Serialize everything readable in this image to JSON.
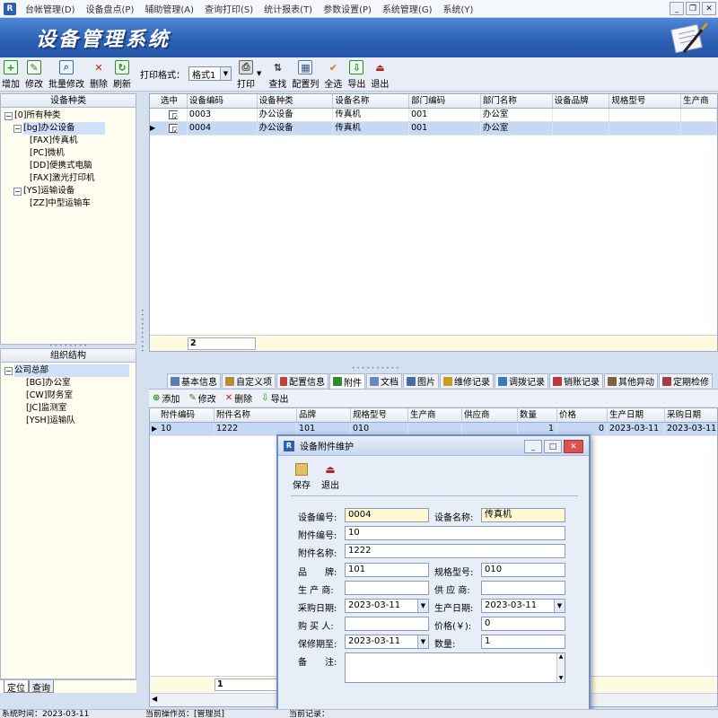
{
  "menubar": {
    "items": [
      "台帐管理(D)",
      "设备盘点(P)",
      "辅助管理(A)",
      "查询打印(S)",
      "统计报表(T)",
      "参数设置(P)",
      "系统管理(G)",
      "系统(Y)"
    ],
    "app_icon": "R"
  },
  "banner": {
    "title": "设备管理系统"
  },
  "toolbar": {
    "buttons": [
      {
        "label": "增加",
        "icon": "add-icon",
        "color": "#2a8f2a"
      },
      {
        "label": "修改",
        "icon": "edit-icon",
        "color": "#3a7a3a"
      },
      {
        "label": "批量修改",
        "icon": "batch-edit-icon",
        "color": "#3a6ab0"
      },
      {
        "label": "删除",
        "icon": "delete-icon",
        "color": "#cc2020"
      },
      {
        "label": "刷新",
        "icon": "refresh-icon",
        "color": "#2a8f2a"
      }
    ],
    "print_format_label": "打印格式：",
    "print_format_value": "格式1",
    "buttons2": [
      {
        "label": "打印",
        "icon": "print-icon"
      },
      {
        "label": "查找",
        "icon": "sort-icon"
      },
      {
        "label": "配置列",
        "icon": "config-columns-icon"
      },
      {
        "label": "全选",
        "icon": "select-all-icon"
      },
      {
        "label": "导出",
        "icon": "export-icon"
      },
      {
        "label": "退出",
        "icon": "exit-icon"
      }
    ]
  },
  "category_panel": {
    "title": "设备种类",
    "nodes": [
      {
        "label": "[0]所有种类",
        "level": 0,
        "toggle": "−"
      },
      {
        "label": "[bg]办公设备",
        "level": 1,
        "toggle": "−",
        "selected": true
      },
      {
        "label": "[FAX]传真机",
        "level": 2
      },
      {
        "label": "[PC]微机",
        "level": 2
      },
      {
        "label": "[DD]便携式电脑",
        "level": 2
      },
      {
        "label": "[FAX]激光打印机",
        "level": 2
      },
      {
        "label": "[YS]运输设备",
        "level": 1,
        "toggle": "−"
      },
      {
        "label": "[ZZ]中型运输车",
        "level": 2
      }
    ]
  },
  "org_panel": {
    "title": "组织结构",
    "nodes": [
      {
        "label": "公司总部",
        "level": 0,
        "toggle": "−",
        "selected": true
      },
      {
        "label": "[BG]办公室",
        "level": 1
      },
      {
        "label": "[CW]财务室",
        "level": 1
      },
      {
        "label": "[JC]监测室",
        "level": 1
      },
      {
        "label": "[YSH]运输队",
        "level": 1
      }
    ]
  },
  "left_tabs": [
    "定位",
    "查询"
  ],
  "main_grid": {
    "columns": [
      "选中",
      "设备编码",
      "设备种类",
      "设备名称",
      "部门编码",
      "部门名称",
      "设备品牌",
      "规格型号",
      "生产商"
    ],
    "rows": [
      {
        "checked": "☑",
        "code": "0003",
        "category": "办公设备",
        "name": "传真机",
        "dept_code": "001",
        "dept_name": "办公室",
        "brand": "",
        "model": "",
        "maker": ""
      },
      {
        "checked": "☑",
        "code": "0004",
        "category": "办公设备",
        "name": "传真机",
        "dept_code": "001",
        "dept_name": "办公室",
        "brand": "",
        "model": "",
        "maker": ""
      }
    ],
    "footer_count": "2"
  },
  "detail_tabs": [
    "基本信息",
    "自定义项",
    "配置信息",
    "附件",
    "文档",
    "图片",
    "维修记录",
    "调拨记录",
    "销账记录",
    "其他异动",
    "定期检修"
  ],
  "detail_toolbar": [
    "添加",
    "修改",
    "删除",
    "导出"
  ],
  "attach_grid": {
    "columns": [
      "附件编码",
      "附件名称",
      "品牌",
      "规格型号",
      "生产商",
      "供应商",
      "数量",
      "价格",
      "生产日期",
      "采购日期"
    ],
    "rows": [
      {
        "code": "10",
        "name": "1222",
        "brand": "101",
        "model": "010",
        "maker": "",
        "supplier": "",
        "qty": "1",
        "price": "0",
        "prod_date": "2023-03-11",
        "buy_date": "2023-03-11"
      }
    ],
    "footer_count": "1"
  },
  "dialog": {
    "title": "设备附件维护",
    "save_label": "保存",
    "exit_label": "退出",
    "fields": {
      "device_code_label": "设备编号:",
      "device_code": "0004",
      "device_name_label": "设备名称:",
      "device_name": "传真机",
      "attach_code_label": "附件编号:",
      "attach_code": "10",
      "attach_name_label": "附件名称:",
      "attach_name": "1222",
      "brand_label": "品　　牌:",
      "brand": "101",
      "model_label": "规格型号:",
      "model": "010",
      "maker_label": "生 产 商:",
      "maker": "",
      "supplier_label": "供 应 商:",
      "supplier": "",
      "buy_date_label": "采购日期:",
      "buy_date": "2023-03-11",
      "prod_date_label": "生产日期:",
      "prod_date": "2023-03-11",
      "buyer_label": "购 买 人:",
      "buyer": "",
      "price_label": "价格(￥):",
      "price": "0",
      "warranty_label": "保修期至:",
      "warranty": "2023-03-11",
      "qty_label": "数量:",
      "qty": "1",
      "note_label": "备　　注:",
      "note": ""
    }
  },
  "statusbar": {
    "date": "系统时间：2023-03-11",
    "operator": "当前操作员：[管理员]",
    "extra": "当前记录："
  }
}
